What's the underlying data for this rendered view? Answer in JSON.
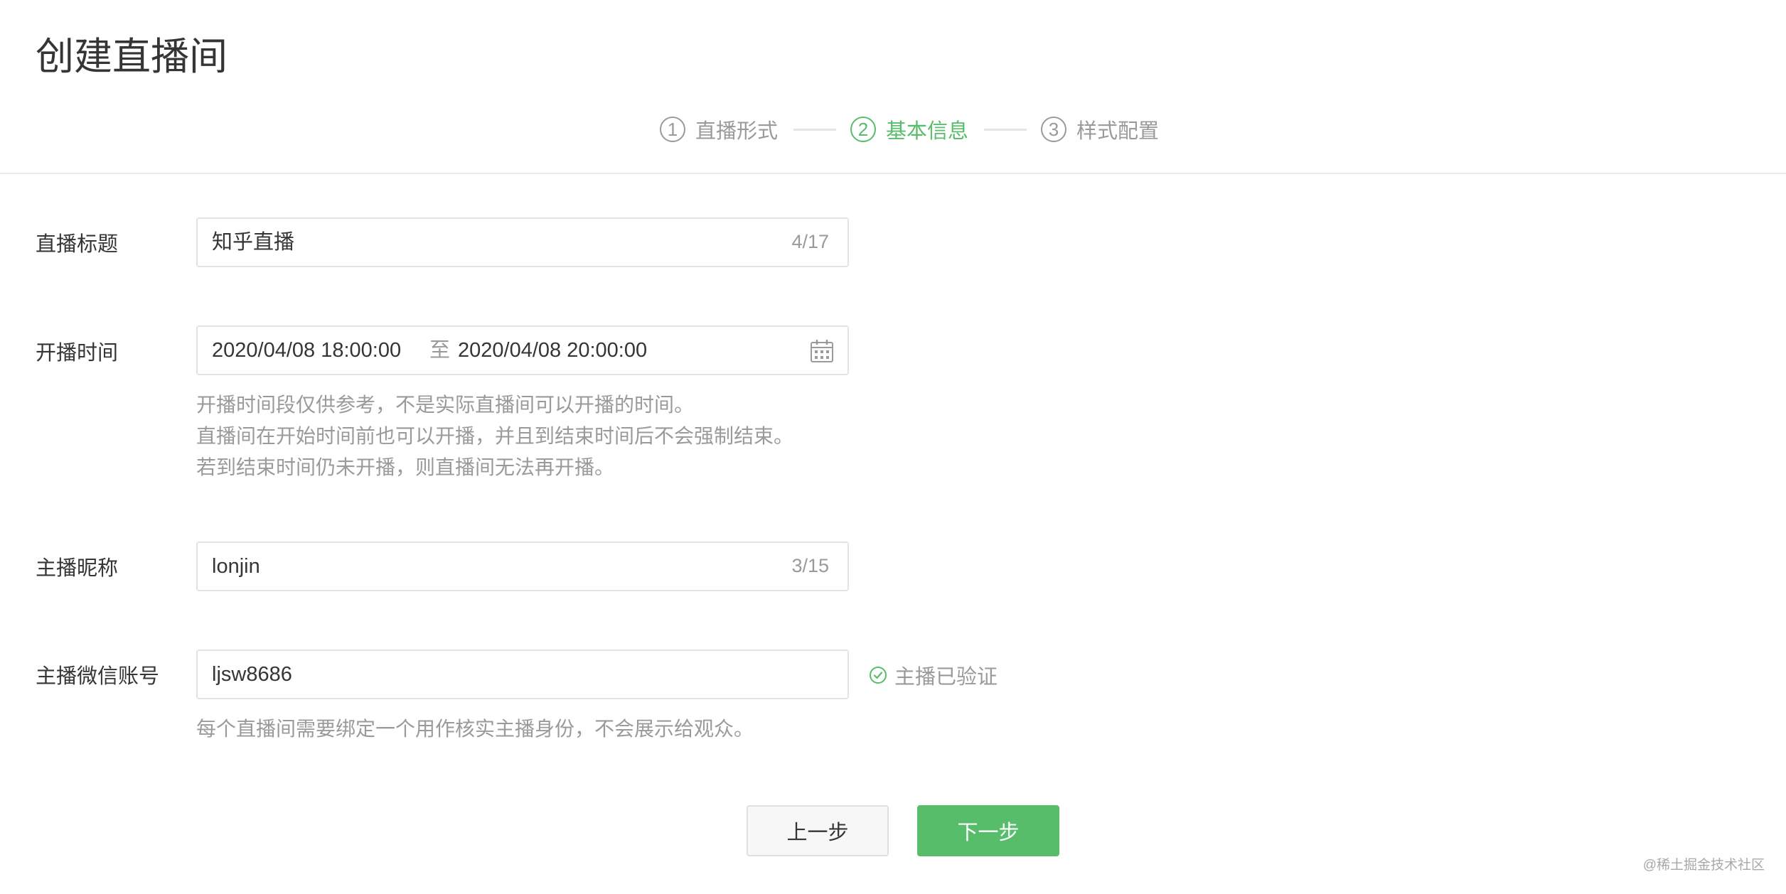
{
  "page": {
    "title": "创建直播间"
  },
  "steps": [
    {
      "number": "1",
      "label": "直播形式",
      "active": false
    },
    {
      "number": "2",
      "label": "基本信息",
      "active": true
    },
    {
      "number": "3",
      "label": "样式配置",
      "active": false
    }
  ],
  "form": {
    "title_field": {
      "label": "直播标题",
      "value": "知乎直播",
      "counter": "4/17"
    },
    "time_field": {
      "label": "开播时间",
      "start": "2020/04/08 18:00:00",
      "separator": "至",
      "end": "2020/04/08 20:00:00",
      "icon": "calendar-icon",
      "hints": [
        "开播时间段仅供参考，不是实际直播间可以开播的时间。",
        "直播间在开始时间前也可以开播，并且到结束时间后不会强制结束。",
        "若到结束时间仍未开播，则直播间无法再开播。"
      ]
    },
    "nickname_field": {
      "label": "主播昵称",
      "value": "lonjin",
      "counter": "3/15"
    },
    "wechat_field": {
      "label": "主播微信账号",
      "value": "ljsw8686",
      "verified_label": "主播已验证",
      "verified_icon": "check-circle-icon",
      "hint": "每个直播间需要绑定一个用作核实主播身份，不会展示给观众。"
    }
  },
  "buttons": {
    "prev_label": "上一步",
    "next_label": "下一步"
  },
  "watermark": "@稀土掘金技术社区",
  "colors": {
    "accent": "#57bd6a",
    "muted": "#9a9a9a",
    "text": "#353535",
    "border": "#e2e2e2"
  }
}
